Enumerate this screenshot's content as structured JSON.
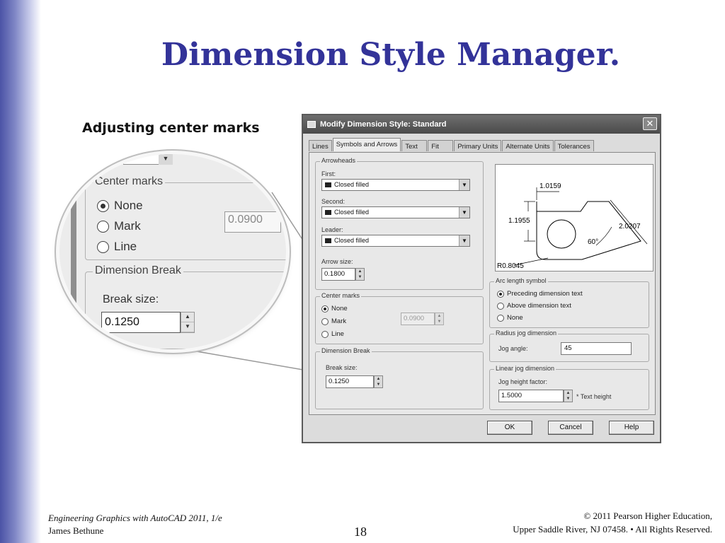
{
  "slide": {
    "title": "Dimension Style Manager.",
    "subtitle": "Adjusting center marks",
    "footer_book": "Engineering Graphics with AutoCAD 2011, 1/e",
    "footer_author": "James Bethune",
    "page_number": "18",
    "footer_copyright_1": "© 2011 Pearson Higher Education,",
    "footer_copyright_2": "Upper Saddle River, NJ 07458. • All Rights Reserved."
  },
  "magnifier": {
    "center_marks_legend": "Center marks",
    "options": [
      "None",
      "Mark",
      "Line"
    ],
    "selected": "None",
    "size_value": "0.0900",
    "dimension_break_legend": "Dimension Break",
    "break_size_label": "Break size:",
    "break_size_value": "0.1250"
  },
  "dialog": {
    "title": "Modify Dimension Style: Standard",
    "close_symbol": "✕",
    "tabs": [
      "Lines",
      "Symbols and Arrows",
      "Text",
      "Fit",
      "Primary Units",
      "Alternate Units",
      "Tolerances"
    ],
    "active_tab": "Symbols and Arrows",
    "arrowheads": {
      "legend": "Arrowheads",
      "first_label": "First:",
      "first_value": "Closed filled",
      "second_label": "Second:",
      "second_value": "Closed filled",
      "leader_label": "Leader:",
      "leader_value": "Closed filled",
      "arrow_size_label": "Arrow size:",
      "arrow_size_value": "0.1800"
    },
    "center_marks": {
      "legend": "Center marks",
      "options": [
        "None",
        "Mark",
        "Line"
      ],
      "selected": "None",
      "size_value": "0.0900"
    },
    "dimension_break": {
      "legend": "Dimension Break",
      "break_size_label": "Break size:",
      "break_size_value": "0.1250"
    },
    "preview": {
      "dim_top": "1.0159",
      "dim_left": "1.1955",
      "dim_slant": "2.0207",
      "angle": "60°",
      "radius": "R0.8045"
    },
    "arc_length_symbol": {
      "legend": "Arc length symbol",
      "options": [
        "Preceding dimension text",
        "Above dimension text",
        "None"
      ],
      "selected": "Preceding dimension text"
    },
    "radius_jog": {
      "legend": "Radius jog dimension",
      "jog_angle_label": "Jog angle:",
      "jog_angle_value": "45"
    },
    "linear_jog": {
      "legend": "Linear jog dimension",
      "height_factor_label": "Jog height factor:",
      "height_factor_value": "1.5000",
      "suffix": "* Text height"
    },
    "buttons": {
      "ok": "OK",
      "cancel": "Cancel",
      "help": "Help"
    }
  }
}
